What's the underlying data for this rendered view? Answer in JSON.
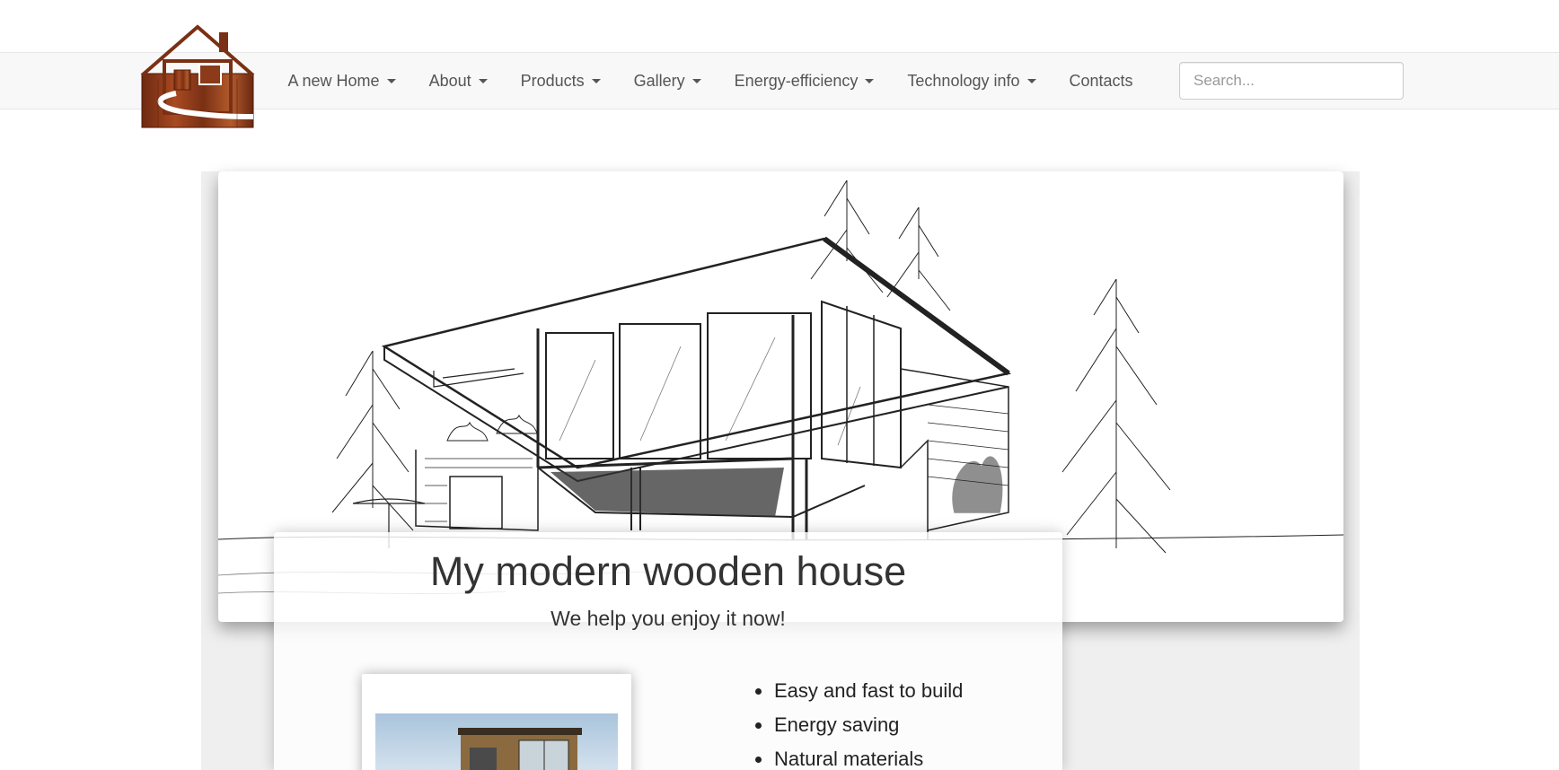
{
  "nav": {
    "items": [
      {
        "label": "A new Home",
        "dropdown": true
      },
      {
        "label": "About",
        "dropdown": true
      },
      {
        "label": "Products",
        "dropdown": true
      },
      {
        "label": "Gallery",
        "dropdown": true
      },
      {
        "label": "Energy-efficiency",
        "dropdown": true
      },
      {
        "label": "Technology info",
        "dropdown": true
      },
      {
        "label": "Contacts",
        "dropdown": false
      }
    ],
    "search_placeholder": "Search..."
  },
  "card": {
    "title": "My modern wooden house",
    "subtitle": "We help you enjoy it now!",
    "features": [
      "Easy and fast to build",
      "Energy saving",
      "Natural materials"
    ]
  },
  "colors": {
    "navbar_bg": "#f8f8f8",
    "logo_wood": "#8b3a1a",
    "content_bg": "#efefef"
  }
}
